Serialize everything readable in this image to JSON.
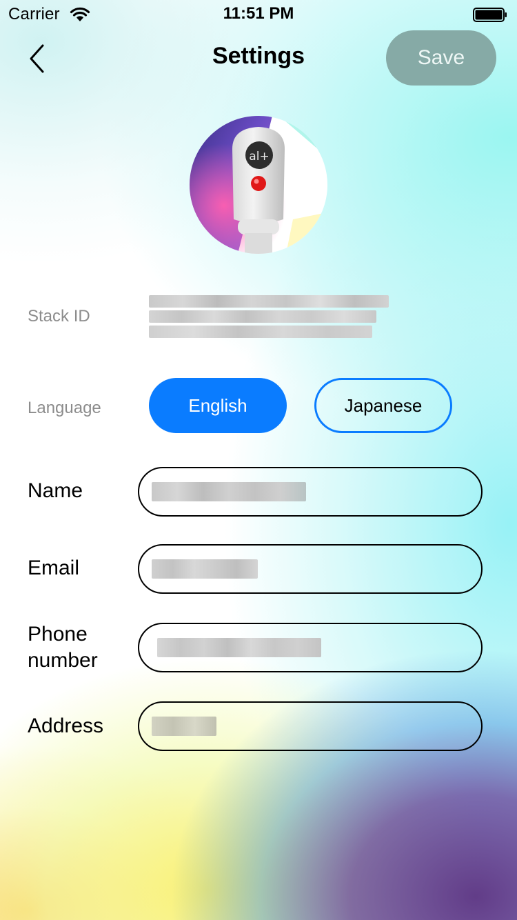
{
  "status_bar": {
    "carrier": "Carrier",
    "time": "11:51 PM",
    "icons": [
      "wifi-icon",
      "battery-icon"
    ]
  },
  "nav": {
    "back_icon": "chevron-left-icon",
    "title": "Settings",
    "save_label": "Save"
  },
  "profile": {
    "avatar_badge": "al+"
  },
  "stack_id": {
    "label": "Stack ID",
    "value_redacted": true
  },
  "language": {
    "label": "Language",
    "options": [
      "English",
      "Japanese"
    ],
    "selected": "English"
  },
  "fields": [
    {
      "label": "Name",
      "value_redacted": true
    },
    {
      "label": "Email",
      "value_redacted": true
    },
    {
      "label": "Phone number",
      "value_redacted": true
    },
    {
      "label": "Address",
      "value_redacted": true
    }
  ],
  "colors": {
    "accent": "#0a7cff",
    "save_button": "#86aaa6",
    "save_text": "#eef7f5",
    "secondary_label": "#8c8c8c"
  }
}
